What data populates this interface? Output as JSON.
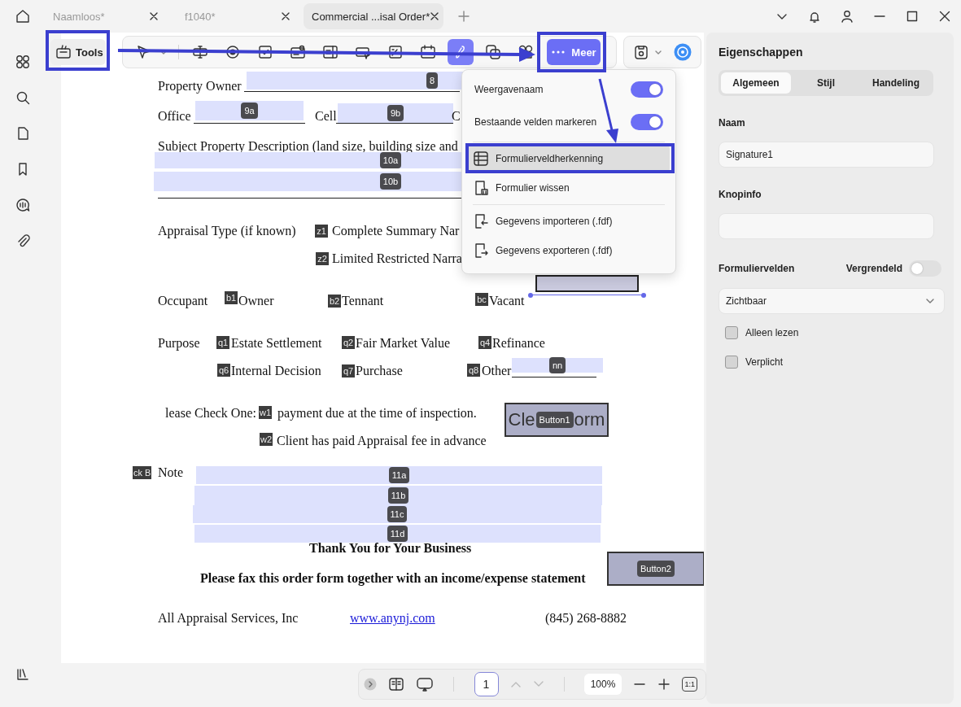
{
  "title_bar": {
    "tabs": [
      {
        "label": "Naamloos*",
        "selected": false
      },
      {
        "label": "f1040*",
        "selected": false
      },
      {
        "label": "Commercial ...isal Order*",
        "selected": true
      }
    ]
  },
  "toolbar": {
    "tools_button": "Tools",
    "tools": [
      {
        "kind": "pointer",
        "selected": false
      },
      {
        "kind": "textfield",
        "selected": false
      },
      {
        "kind": "radio",
        "selected": false
      },
      {
        "kind": "checkbox",
        "selected": false
      },
      {
        "kind": "combo",
        "selected": false
      },
      {
        "kind": "list",
        "selected": false
      },
      {
        "kind": "button",
        "selected": false
      },
      {
        "kind": "image",
        "selected": false
      },
      {
        "kind": "date",
        "selected": false
      },
      {
        "kind": "signature",
        "selected": true
      },
      {
        "kind": "copy",
        "selected": false
      },
      {
        "kind": "arrange",
        "selected": false
      }
    ],
    "more_button": "Meer"
  },
  "more_menu": {
    "items": [
      {
        "kind": "toggle",
        "label": "Weergavenaam",
        "on": true
      },
      {
        "kind": "toggle",
        "label": "Bestaande velden markeren",
        "on": true
      },
      {
        "kind": "action",
        "label": "Formulierveldherkenning",
        "selected": true
      },
      {
        "kind": "action",
        "label": "Formulier wissen",
        "selected": false
      },
      {
        "kind": "action",
        "label": "Gegevens importeren (.fdf)",
        "selected": false
      },
      {
        "kind": "action",
        "label": "Gegevens exporteren (.fdf)",
        "selected": false
      }
    ]
  },
  "document": [
    {
      "kind": "text",
      "text": "Property Owner"
    },
    {
      "kind": "field",
      "tag": "8"
    },
    {
      "kind": "text",
      "text": "Office"
    },
    {
      "kind": "field",
      "tag": "9a"
    },
    {
      "kind": "text",
      "text": "Cell"
    },
    {
      "kind": "field",
      "tag": "9b"
    },
    {
      "kind": "text",
      "text": "C"
    },
    {
      "kind": "text",
      "text": "Subject Property Description (land size, building size and"
    },
    {
      "kind": "field",
      "tag": "10a"
    },
    {
      "kind": "field",
      "tag": "10b"
    },
    {
      "kind": "text",
      "text": "Appraisal Type (if known)"
    },
    {
      "kind": "check",
      "tag": "z1"
    },
    {
      "kind": "text",
      "text": "Complete Summary Nar"
    },
    {
      "kind": "check",
      "tag": "z2"
    },
    {
      "kind": "text",
      "text": "Limited Restricted Narra"
    },
    {
      "kind": "text",
      "text": "Occupant"
    },
    {
      "kind": "check",
      "tag": "b1"
    },
    {
      "kind": "text",
      "text": "Owner"
    },
    {
      "kind": "check",
      "tag": "b2"
    },
    {
      "kind": "text",
      "text": "Tennant"
    },
    {
      "kind": "check",
      "tag": "bc"
    },
    {
      "kind": "text",
      "text": "Vacant"
    },
    {
      "kind": "signature",
      "selected": true
    },
    {
      "kind": "text",
      "text": "Purpose"
    },
    {
      "kind": "check",
      "tag": "q1"
    },
    {
      "kind": "text",
      "text": "Estate Settlement"
    },
    {
      "kind": "check",
      "tag": "q2"
    },
    {
      "kind": "text",
      "text": "Fair Market Value"
    },
    {
      "kind": "check",
      "tag": "q4"
    },
    {
      "kind": "text",
      "text": "Refinance"
    },
    {
      "kind": "check",
      "tag": "q6"
    },
    {
      "kind": "text",
      "text": "Internal Decision"
    },
    {
      "kind": "check",
      "tag": "q7"
    },
    {
      "kind": "text",
      "text": "Purchase"
    },
    {
      "kind": "check",
      "tag": "q8"
    },
    {
      "kind": "text",
      "text": "Other"
    },
    {
      "kind": "field",
      "tag": "nn"
    },
    {
      "kind": "text",
      "text": "lease Check One:"
    },
    {
      "kind": "check",
      "tag": "w1"
    },
    {
      "kind": "text",
      "text": "payment due at the time of inspection."
    },
    {
      "kind": "button",
      "text_parts": [
        "Cle",
        "orm"
      ],
      "tag": "Button1"
    },
    {
      "kind": "check",
      "tag": "w2"
    },
    {
      "kind": "text",
      "text": "Client has paid Appraisal fee in advance"
    },
    {
      "kind": "check",
      "tag": "ck B"
    },
    {
      "kind": "text",
      "text": "Note"
    },
    {
      "kind": "field",
      "tag": "11a"
    },
    {
      "kind": "field",
      "tag": "11b"
    },
    {
      "kind": "field",
      "tag": "11c"
    },
    {
      "kind": "field",
      "tag": "11d"
    },
    {
      "kind": "bold",
      "text": "Thank You for Your Business"
    },
    {
      "kind": "bold",
      "text": "Please fax this order form together with an income/expense statement"
    },
    {
      "kind": "button",
      "tag": "Button2"
    },
    {
      "kind": "text",
      "text": "All Appraisal Services, Inc"
    },
    {
      "kind": "link",
      "text": "www.anynj.com"
    },
    {
      "kind": "text",
      "text": "(845) 268-8882"
    }
  ],
  "page_bar": {
    "page": "1",
    "zoom": "100%",
    "actual_size": "1:1"
  },
  "properties": {
    "title": "Eigenschappen",
    "tabs": [
      {
        "label": "Algemeen",
        "selected": true
      },
      {
        "label": "Stijl",
        "selected": false
      },
      {
        "label": "Handeling",
        "selected": false
      }
    ],
    "name_label": "Naam",
    "name_value": "Signature1",
    "tooltip_label": "Knopinfo",
    "form_fields_label": "Formuliervelden",
    "locked_label": "Vergrendeld",
    "locked": false,
    "visibility": "Zichtbaar",
    "checkboxes": [
      {
        "label": "Alleen lezen",
        "checked": false
      },
      {
        "label": "Verplicht",
        "checked": false
      }
    ]
  }
}
